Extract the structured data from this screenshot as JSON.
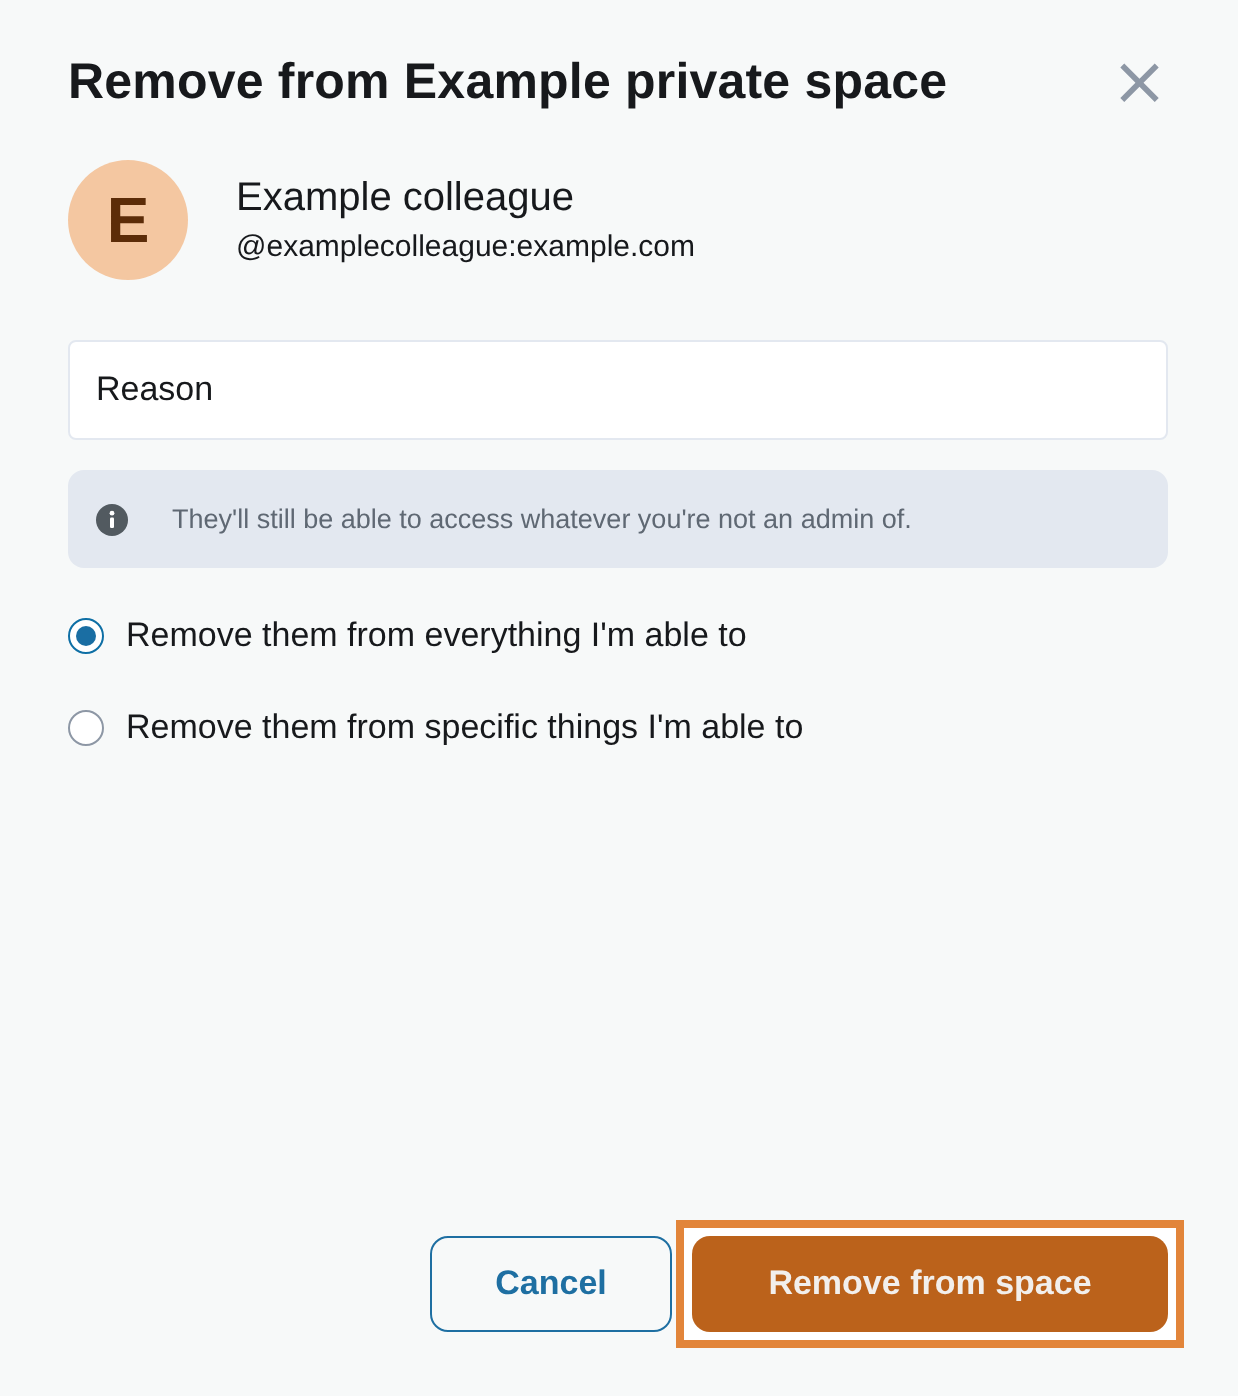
{
  "dialog": {
    "title": "Remove from Example private space",
    "close": "×"
  },
  "user": {
    "initial": "E",
    "name": "Example colleague",
    "id": "@examplecolleague:example.com"
  },
  "reason": {
    "placeholder": "Reason"
  },
  "notice": {
    "text": "They'll still be able to access whatever you're not an admin of."
  },
  "options": [
    {
      "label": "Remove them from everything I'm able to",
      "selected": true
    },
    {
      "label": "Remove them from specific things I'm able to",
      "selected": false
    }
  ],
  "buttons": [
    {
      "label": "Cancel",
      "kind": "secondary",
      "focused": false
    },
    {
      "label": "Remove from space",
      "kind": "primary",
      "focused": true
    }
  ]
}
